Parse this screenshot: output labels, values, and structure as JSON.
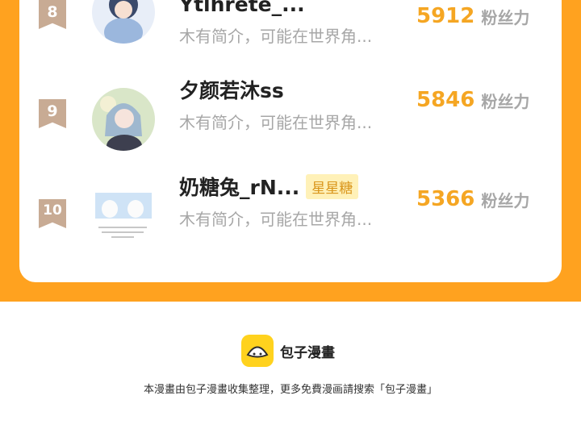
{
  "ranking": [
    {
      "rank": "8",
      "name": "Ytlhrete_...",
      "tag": "",
      "bio": "木有简介，可能在世界角...",
      "fans": "5912",
      "fans_unit": "粉丝力"
    },
    {
      "rank": "9",
      "name": "夕颜若沐ss",
      "tag": "",
      "bio": "木有简介，可能在世界角...",
      "fans": "5846",
      "fans_unit": "粉丝力"
    },
    {
      "rank": "10",
      "name": "奶糖兔_rN...",
      "tag": "星星糖",
      "bio": "木有简介，可能在世界角...",
      "fans": "5366",
      "fans_unit": "粉丝力"
    }
  ],
  "footer": {
    "brand": "包子漫畫",
    "note": "本漫畫由包子漫畫收集整理，更多免費漫画請搜索「包子漫畫」"
  },
  "colors": {
    "accent": "#ffa21f",
    "score": "#f5a623",
    "badge": "#c8ab94",
    "tag_bg": "#fff1b8"
  }
}
